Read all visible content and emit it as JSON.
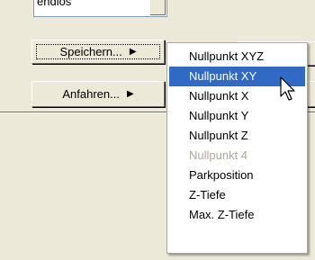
{
  "combo": {
    "value": "endlos"
  },
  "buttons": {
    "save_label": "Speichern...",
    "save_arrow": "▶",
    "go_label": "Anfahren...",
    "go_arrow": "▶"
  },
  "menu": {
    "items": [
      {
        "label": "Nullpunkt XYZ",
        "state": "normal"
      },
      {
        "label": "Nullpunkt XY",
        "state": "selected"
      },
      {
        "label": "Nullpunkt X",
        "state": "normal"
      },
      {
        "label": "Nullpunkt Y",
        "state": "normal"
      },
      {
        "label": "Nullpunkt Z",
        "state": "normal"
      },
      {
        "label": "Nullpunkt 4",
        "state": "disabled"
      },
      {
        "label": "Parkposition",
        "state": "normal"
      },
      {
        "label": "Z-Tiefe",
        "state": "normal"
      },
      {
        "label": "Max. Z-Tiefe",
        "state": "normal"
      }
    ]
  },
  "colors": {
    "window_bg": "#ece9d8",
    "menu_bg": "#ffffff",
    "highlight": "#316ac5",
    "disabled_text": "#aca899"
  },
  "icons": {
    "cursor": "arrow-pointer-icon",
    "dropdown": "chevron-down-icon",
    "submenu": "triangle-right-icon"
  }
}
